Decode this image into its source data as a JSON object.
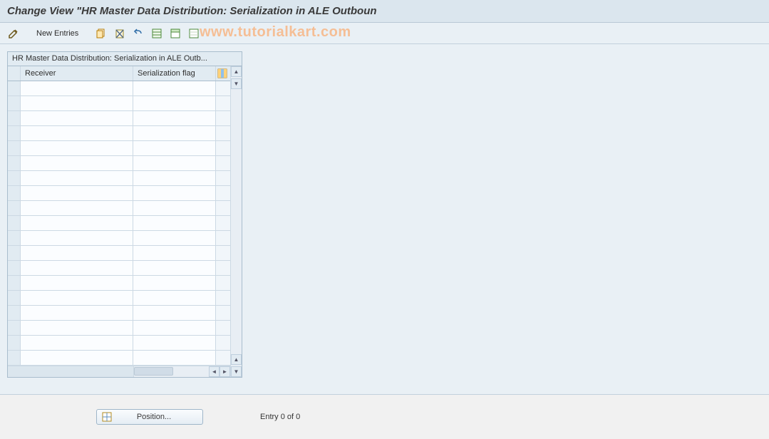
{
  "title": "Change View \"HR Master Data Distribution: Serialization in ALE Outboun",
  "toolbar": {
    "new_entries_label": "New Entries"
  },
  "watermark": "www.tutorialkart.com",
  "panel": {
    "title": "HR Master Data Distribution: Serialization in ALE Outb...",
    "columns": {
      "receiver": "Receiver",
      "serialization_flag": "Serialization flag"
    },
    "row_count": 19
  },
  "footer": {
    "position_label": "Position...",
    "entry_status": "Entry 0 of 0"
  }
}
